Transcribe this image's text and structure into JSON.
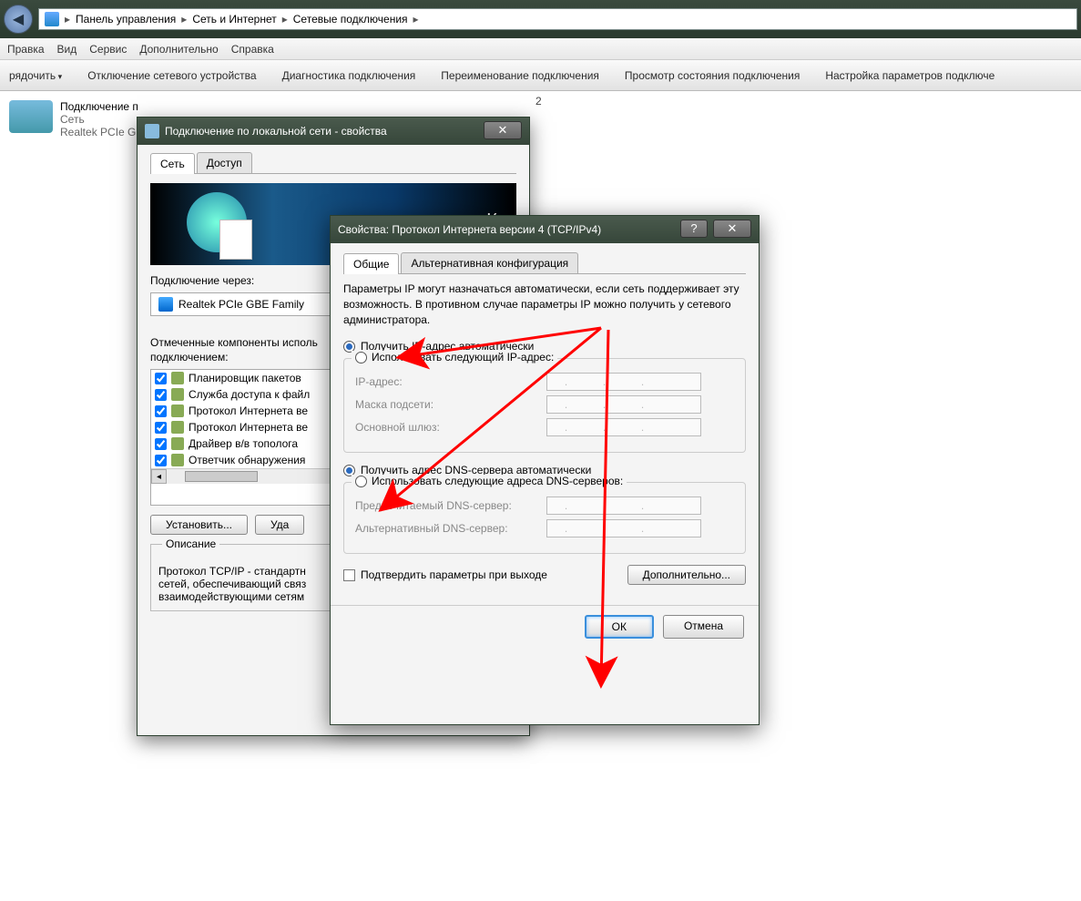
{
  "explorer": {
    "breadcrumb": [
      "Панель управления",
      "Сеть и Интернет",
      "Сетевые подключения"
    ],
    "menu": {
      "edit": "Правка",
      "view": "Вид",
      "service": "Сервис",
      "more": "Дополнительно",
      "help": "Справка"
    },
    "toolbar": {
      "organize": "рядочить",
      "disable": "Отключение сетевого устройства",
      "diag": "Диагностика подключения",
      "rename": "Переименование подключения",
      "status": "Просмотр состояния подключения",
      "settings": "Настройка параметров подключе"
    },
    "connection": {
      "name": "Подключение п",
      "line2": "Сеть",
      "line3": "Realtek PCIe GBE",
      "extra_badge": "2"
    }
  },
  "dlg1": {
    "title": "Подключение по локальной сети - свойства",
    "tabs": {
      "net": "Сеть",
      "access": "Доступ"
    },
    "banner_text": "Ко",
    "connect_via_label": "Подключение через:",
    "adapter": "Realtek PCIe GBE Family",
    "components_label_1": "Отмеченные компоненты исполь",
    "components_label_2": "подключением:",
    "components": [
      "Планировщик пакетов",
      "Служба доступа к файл",
      "Протокол Интернета ве",
      "Протокол Интернета ве",
      "Драйвер в/в тополога",
      "Ответчик обнаружения"
    ],
    "install_btn": "Установить...",
    "uninstall_btn": "Уда",
    "desc_title": "Описание",
    "desc_1": "Протокол TCP/IP - стандартн",
    "desc_2": "сетей, обеспечивающий связ",
    "desc_3": "взаимодействующими сетям"
  },
  "dlg2": {
    "title": "Свойства: Протокол Интернета версии 4 (TCP/IPv4)",
    "tabs": {
      "general": "Общие",
      "alt": "Альтернативная конфигурация"
    },
    "intro": "Параметры IP могут назначаться автоматически, если сеть поддерживает эту возможность. В противном случае параметры IP можно получить у сетевого администратора.",
    "ip_auto": "Получить IP-адрес автоматически",
    "ip_manual": "Использовать следующий IP-адрес:",
    "ip_addr": "IP-адрес:",
    "subnet": "Маска подсети:",
    "gateway": "Основной шлюз:",
    "dns_auto": "Получить адрес DNS-сервера автоматически",
    "dns_manual": "Использовать следующие адреса DNS-серверов:",
    "dns_pref": "Предпочитаемый DNS-сервер:",
    "dns_alt": "Альтернативный DNS-сервер:",
    "confirm_exit": "Подтвердить параметры при выходе",
    "advanced": "Дополнительно...",
    "ok": "ОК",
    "cancel": "Отмена"
  }
}
